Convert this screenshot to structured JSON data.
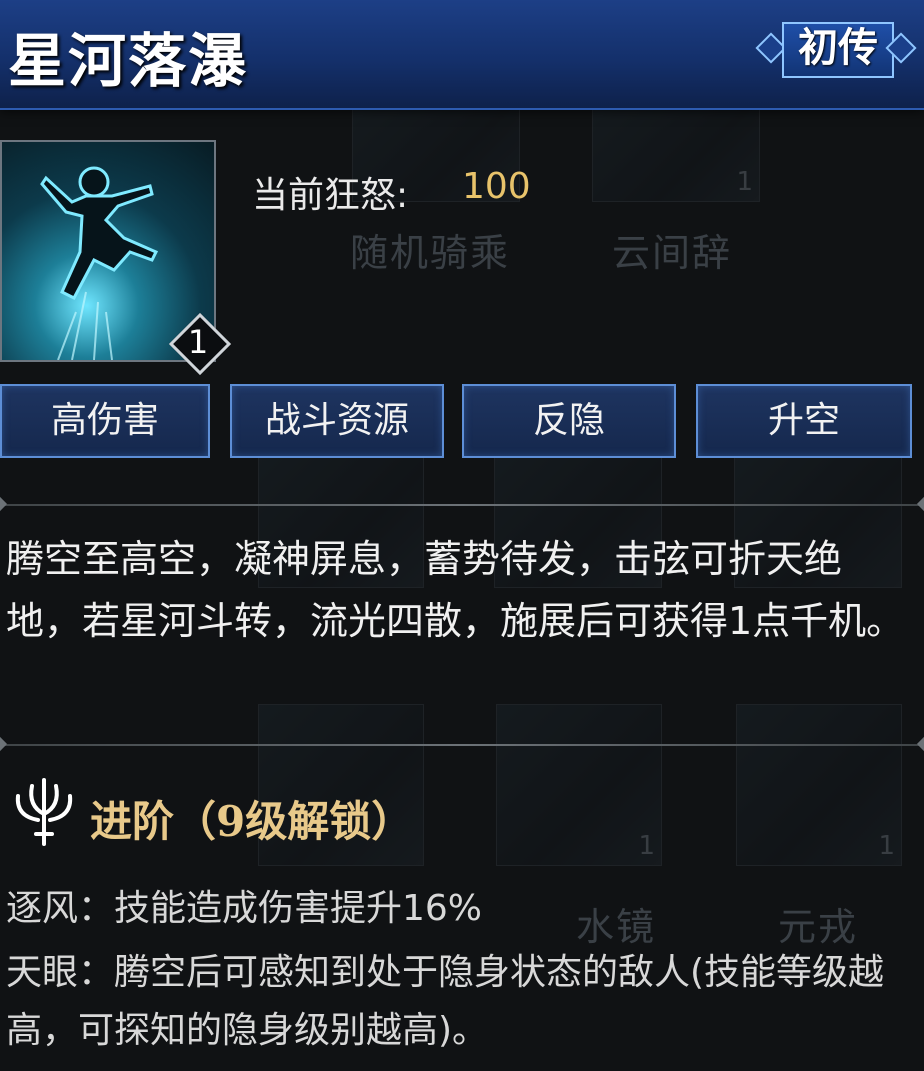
{
  "skill": {
    "name": "星河落瀑",
    "rank_badge": "初传",
    "level": "1",
    "rage_label": "当前狂怒:",
    "rage_value": "100",
    "tags": [
      "高伤害",
      "战斗资源",
      "反隐",
      "升空"
    ],
    "description": "腾空至高空，凝神屏息，蓄势待发，击弦可折天绝地，若星河斗转，流光四散，施展后可获得1点千机。"
  },
  "advancement": {
    "title": "进阶（9级解锁）",
    "icon": "trident-icon",
    "items": [
      {
        "text": "逐风：技能造成伤害提升16%"
      },
      {
        "text": "天眼：腾空后可感知到处于隐身状态的敌人(技能等级越高，可探知的隐身级别越高)。"
      }
    ]
  },
  "background_ghost": {
    "labels": [
      "随机骑乘",
      "云间辞",
      "水镜",
      "元戎"
    ],
    "counts": [
      "1",
      "1",
      "1"
    ]
  },
  "colors": {
    "header": "#1d3f86",
    "tag_border": "#5d8ed6",
    "gold": "#e8c36b"
  }
}
